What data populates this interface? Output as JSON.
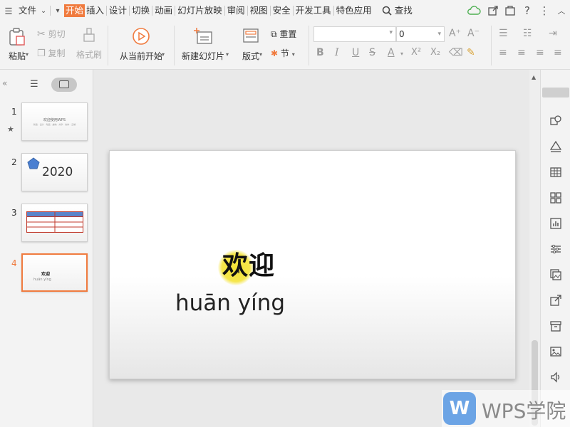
{
  "menubar": {
    "file_label": "文件",
    "tabs": [
      "开始",
      "插入",
      "设计",
      "切换",
      "动画",
      "幻灯片放映",
      "审阅",
      "视图",
      "安全",
      "开发工具",
      "特色应用"
    ],
    "active_tab": "开始",
    "search_label": "查找"
  },
  "ribbon": {
    "paste": "粘贴",
    "cut": "剪切",
    "copy": "复制",
    "format_painter": "格式刷",
    "from_current": "从当前开始",
    "new_slide": "新建幻灯片",
    "layout": "版式",
    "reset": "重置",
    "section": "节",
    "font_name": "",
    "font_size": "0",
    "bold": "B",
    "italic": "I",
    "underline": "U",
    "strike": "S",
    "font_color": "A",
    "superscript": "X²",
    "subscript": "X₂",
    "grow": "A⁺",
    "shrink": "A⁻"
  },
  "slides": [
    {
      "num": "1",
      "title": "欢迎使用WPS",
      "sub": "新建 · 设计 · 动画 · 放映 · 共享 · 协作 · 云端"
    },
    {
      "num": "2",
      "text": "2020"
    },
    {
      "num": "3"
    },
    {
      "num": "4",
      "title": "欢迎",
      "sub": "huān yíng"
    }
  ],
  "slide": {
    "title": "欢迎",
    "pinyin": "huān yíng"
  },
  "watermark": {
    "logo": "W",
    "text": "WPS学院"
  },
  "colors": {
    "accent": "#f07b3f",
    "highlight": "#f4e22c",
    "wps_blue": "#4a90e2"
  }
}
